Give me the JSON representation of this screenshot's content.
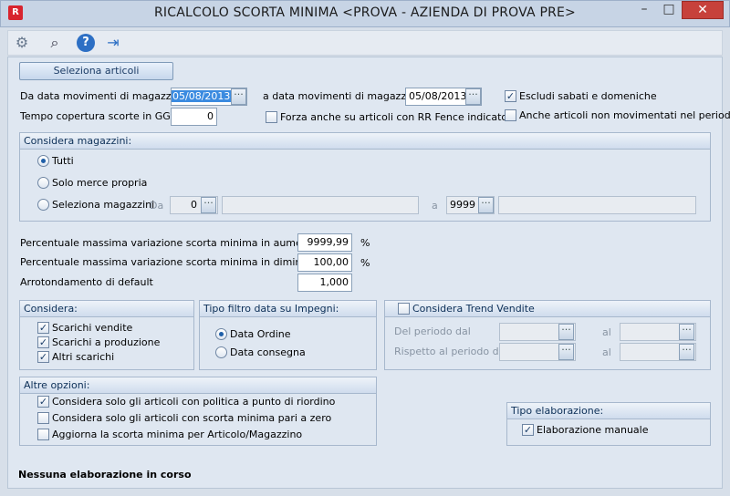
{
  "window": {
    "title": "RICALCOLO SCORTA MINIMA <PROVA - AZIENDA DI PROVA PRE>",
    "minimize": "–",
    "maximize": "□",
    "close": "✕",
    "app_icon": "R"
  },
  "toolbar": {
    "settings": "⚙",
    "binoculars": "⌕",
    "help": "?",
    "exit": "⇥"
  },
  "form": {
    "select_articles": "Seleziona articoli",
    "from_date_label": "Da data movimenti di magazzino",
    "from_date": "05/08/2013",
    "to_date_label": "a data movimenti di magazzino",
    "to_date": "05/08/2013",
    "exclude_weekends": "Escludi sabati e domeniche",
    "exclude_weekends_checked": "✓",
    "coverage_label": "Tempo copertura scorte in GG",
    "coverage_value": "0",
    "force_rr": "Forza anche su articoli con RR Fence indicato",
    "not_moved": "Anche articoli non movimentati nel periodo",
    "date_btn": "···"
  },
  "warehouses": {
    "title": "Considera magazzini:",
    "all": "Tutti",
    "own": "Solo merce propria",
    "select": "Seleziona magazzini",
    "from_label": "Da",
    "from_value": "0",
    "to_label": "a",
    "to_value": "9999",
    "from_desc": "",
    "to_desc": ""
  },
  "percent": {
    "increase_label": "Percentuale massima variazione scorta minima in aumento",
    "increase": "9999,99",
    "decrease_label": "Percentuale massima variazione scorta minima in diminuzione",
    "decrease": "100,00",
    "unit": "%",
    "rounding_label": "Arrotondamento di default",
    "rounding": "1,000"
  },
  "consider": {
    "title": "Considera:",
    "items": [
      "Scarichi vendite",
      "Scarichi a produzione",
      "Altri scarichi"
    ],
    "check": "✓"
  },
  "filter": {
    "title": "Tipo filtro data su Impegni:",
    "order": "Data Ordine",
    "delivery": "Data consegna"
  },
  "trend": {
    "title": "Considera Trend Vendite",
    "period_from": "Del periodo dal",
    "compare_from": "Rispetto al periodo dal",
    "al": "al"
  },
  "other": {
    "title": "Altre opzioni:",
    "opt1": "Considera solo gli articoli con politica a punto di riordino",
    "opt2": "Considera solo gli articoli con scorta minima pari a zero",
    "opt3": "Aggiorna la scorta minima per Articolo/Magazzino",
    "check": "✓"
  },
  "processing": {
    "title": "Tipo elaborazione:",
    "manual": "Elaborazione manuale",
    "check": "✓"
  },
  "status": "Nessuna elaborazione in corso"
}
